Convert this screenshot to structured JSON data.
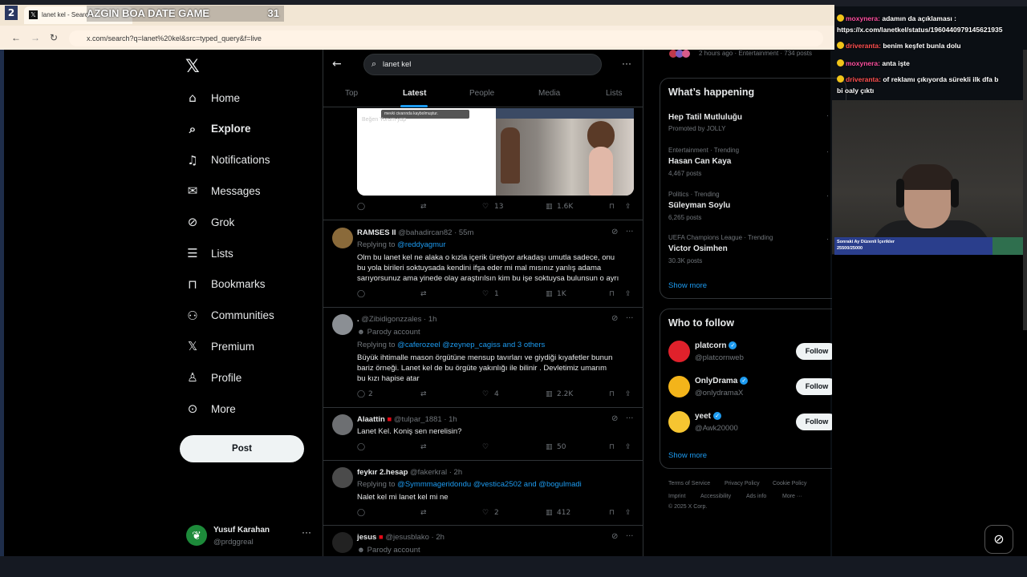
{
  "overlay": {
    "workspace": "2",
    "game_title": "AZGIN BOA DATE GAME",
    "game_count": "31"
  },
  "browser": {
    "tab_title": "lanet kel - Search",
    "url": "x.com/search?q=lanet%20kel&src=typed_query&f=live"
  },
  "nav": {
    "items": [
      {
        "label": "Home",
        "icon": "home-icon"
      },
      {
        "label": "Explore",
        "icon": "search-icon"
      },
      {
        "label": "Notifications",
        "icon": "bell-icon"
      },
      {
        "label": "Messages",
        "icon": "envelope-icon"
      },
      {
        "label": "Grok",
        "icon": "grok-icon"
      },
      {
        "label": "Lists",
        "icon": "list-icon"
      },
      {
        "label": "Bookmarks",
        "icon": "bookmark-icon"
      },
      {
        "label": "Communities",
        "icon": "people-icon"
      },
      {
        "label": "Premium",
        "icon": "x-icon"
      },
      {
        "label": "Profile",
        "icon": "person-icon"
      },
      {
        "label": "More",
        "icon": "more-circle-icon"
      }
    ],
    "post_label": "Post",
    "profile_name": "Yusuf Karahan",
    "profile_handle": "@prdggreal"
  },
  "search": {
    "query": "lanet kel",
    "tabs": [
      "Top",
      "Latest",
      "People",
      "Media",
      "Lists"
    ],
    "active_tab": "Latest"
  },
  "media": {
    "caption": "mevki civarında kaybolmuştur.",
    "faded_actions": "Beğen     Yorum yap"
  },
  "first_actions": {
    "likes": "13",
    "views": "1.6K"
  },
  "tweets": [
    {
      "name": "RAMSES II",
      "handle": "@bahadircan82",
      "time": "· 55m",
      "replying_prefix": "Replying to ",
      "replying": "@reddyagmur",
      "lines": [
        "Olm bu lanet kel ne alaka o kızla içerik üretiyor arkadaşı umutla sadece, onu",
        "bu yola birileri soktuysada kendini ifşa eder mi mal mısınız yanlış adama",
        "sarıyorsunuz ama yinede olay araştırılsın kim bu işe soktuysa bulunsun o ayrı"
      ],
      "replies": "",
      "likes": "1",
      "views": "1K"
    },
    {
      "name": ".",
      "handle": "@Zibidigonzzales",
      "time": "· 1h",
      "parody": "Parody account",
      "replying_prefix": "Replying to ",
      "replying": "@caferozeel @zeynep_cagiss and 3 others",
      "lines": [
        "Büyük ihtimalle mason örgütüne mensup tavırları ve giydiği kıyafetler bunun",
        "bariz örneği. Lanet kel de bu örgüte yakınlığı ile bilinir . Devletimiz umarım",
        "bu kızı hapise atar"
      ],
      "replies": "2",
      "likes": "4",
      "views": "2.2K"
    },
    {
      "name": "Alaattin",
      "flag": "🇹🇷",
      "handle": "@tulpar_1881",
      "time": "· 1h",
      "lines": [
        "Lanet Kel. Koniş sen nerelisin?"
      ],
      "replies": "",
      "likes": "",
      "views": "50"
    },
    {
      "name": "feykır 2.hesap",
      "handle": "@fakerkral",
      "time": "· 2h",
      "replying_prefix": "Replying to ",
      "replying": "@Symmmageridondu @vestica2502 and @bogulmadi",
      "lines": [
        "Nalet kel mi lanet kel mi ne"
      ],
      "replies": "",
      "likes": "2",
      "views": "412"
    },
    {
      "name": "jesus",
      "flag": "🇹🇷",
      "handle": "@jesusblako",
      "time": "· 2h",
      "parody": "Parody account"
    }
  ],
  "right": {
    "top_meta": "2 hours ago · Entertainment · 734 posts",
    "happening_title": "What’s happening",
    "trends": [
      {
        "meta": "",
        "name": "Hep Tatil Mutluluğu",
        "sub": "Promoted by JOLLY"
      },
      {
        "meta": "Entertainment · Trending",
        "name": "Hasan Can Kaya",
        "sub": "4,467 posts"
      },
      {
        "meta": "Politics · Trending",
        "name": "Süleyman Soylu",
        "sub": "6,265 posts"
      },
      {
        "meta": "UEFA Champions League · Trending",
        "name": "Victor Osimhen",
        "sub": "30.3K posts"
      }
    ],
    "show_more": "Show more",
    "who_title": "Who to follow",
    "follow": [
      {
        "name": "platcorn",
        "handle": "@platcornweb",
        "button": "Follow",
        "color": "#e0212b"
      },
      {
        "name": "OnlyDrama",
        "handle": "@onlydramaX",
        "button": "Follow",
        "color": "#f3b41a"
      },
      {
        "name": "yeet",
        "handle": "@Awk20000",
        "button": "Follow",
        "color": "#f6c531"
      }
    ],
    "footer": {
      "row1": [
        "Terms of Service",
        "Privacy Policy",
        "Cookie Policy"
      ],
      "row2": [
        "Imprint",
        "Accessibility",
        "Ads info",
        "More ···"
      ],
      "copyright": "© 2025 X Corp."
    }
  },
  "chat": {
    "messages": [
      {
        "user": "moxynera:",
        "text": "adamın da açıklaması :"
      },
      {
        "user": "",
        "text": "https://x.com/lanetkel/status/1960440979145621935"
      },
      {
        "user": "driveranta:",
        "text": "benim keşfet bunla dolu"
      },
      {
        "user": "moxynera:",
        "text": "anta işte"
      },
      {
        "user": "driveranta:",
        "text": "of reklamı çıkıyorda sürekli ilk dfa b"
      },
      {
        "user": "",
        "text": "bi oaly çıktı"
      }
    ],
    "sub_goal_title": "Sonraki Ay Düzenli İçerikler",
    "sub_goal_value": "25500/25000"
  },
  "colors": {
    "accent": "#1d9bf0",
    "background": "#000000",
    "muted": "#71767b"
  }
}
